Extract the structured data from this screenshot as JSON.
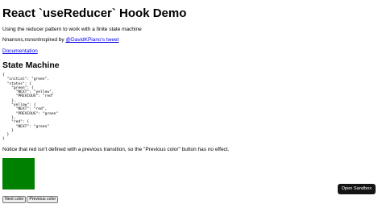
{
  "title": "React `useReducer` Hook Demo",
  "intro": "Using the reducer pattern to work with a finite state machine",
  "inspired": {
    "prefix": "Nnansns,nsnsnInspired by ",
    "link": "@DavidKPiano's tweet"
  },
  "docs_link": "Documentation",
  "section_title": "State Machine",
  "state_machine_code": "{\n  \"initial\": \"green\",\n  \"states\": {\n    \"green\": {\n      \"NEXT\": \"yellow\",\n      \"PREVIOUS\": \"red\"\n    },\n    \"yellow\": {\n      \"NEXT\": \"red\",\n      \"PREVIOUS\": \"green\"\n    },\n    \"red\": {\n      \"NEXT\": \"green\"\n    }\n  }\n}",
  "note": "Notice that red isn't defined with a previous transition, so the \"Previous color\" button has no effect.",
  "light_color": "#008000",
  "buttons": {
    "next": "Next color",
    "previous": "Previous color"
  },
  "open_sandbox": "Open Sandbox"
}
